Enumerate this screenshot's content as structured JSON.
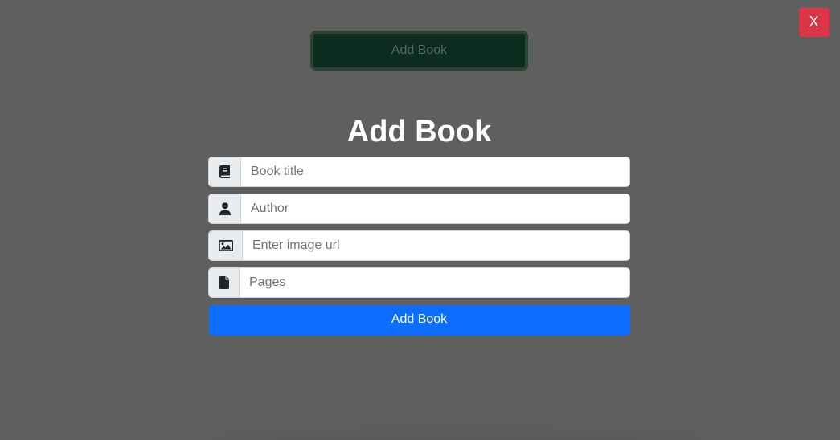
{
  "background_button": {
    "label": "Add Book"
  },
  "close_button": {
    "label": "X"
  },
  "form": {
    "title": "Add Book",
    "fields": [
      {
        "icon": "book-icon",
        "placeholder": "Book title",
        "value": ""
      },
      {
        "icon": "user-icon",
        "placeholder": "Author",
        "value": ""
      },
      {
        "icon": "image-icon",
        "placeholder": "Enter image url",
        "value": ""
      },
      {
        "icon": "file-icon",
        "placeholder": "Pages",
        "value": ""
      }
    ],
    "submit_label": "Add Book"
  },
  "colors": {
    "overlay": "#5f5f5f",
    "close": "#dc3545",
    "primary": "#0d6efd",
    "background_button": "#0b2c1e"
  }
}
